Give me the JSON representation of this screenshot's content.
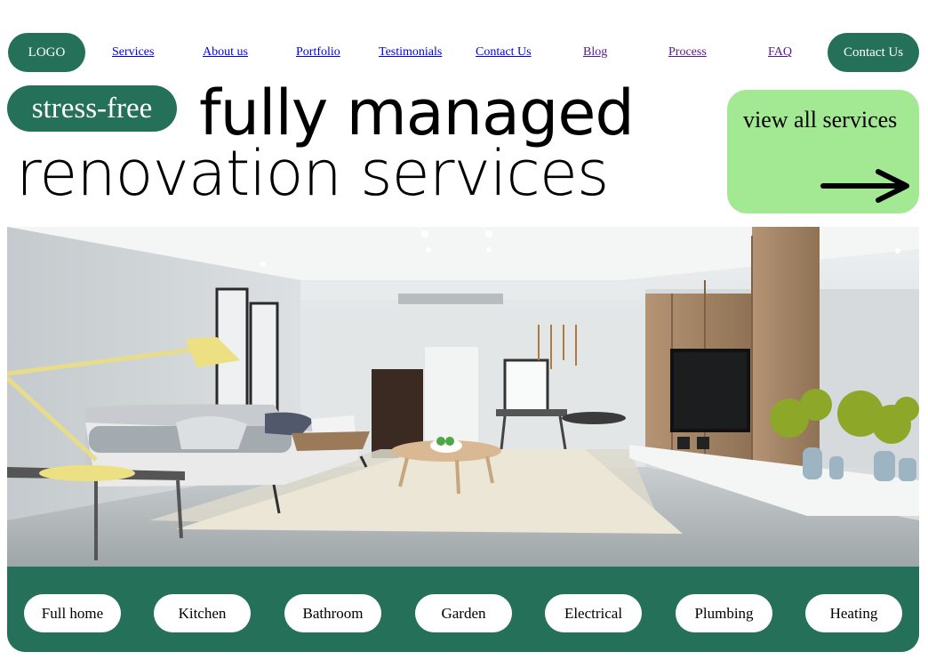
{
  "nav": {
    "logo": "LOGO",
    "links": [
      "Services",
      "About us",
      "Portfolio",
      "Testimonials",
      "Contact Us",
      "Blog",
      "Process",
      "FAQ"
    ],
    "cta": "Contact Us"
  },
  "hero": {
    "badge": "stress-free",
    "headline_line1": "fully managed",
    "headline_line2": "renovation services",
    "services_card": "view all services"
  },
  "categories": [
    "Full home",
    "Kitchen",
    "Bathroom",
    "Garden",
    "Electrical",
    "Plumbing",
    "Heating"
  ],
  "colors": {
    "brand_green": "#247058",
    "card_green": "#a3e994",
    "link_blue": "#0000ee",
    "link_visited": "#551a8b"
  },
  "icons": {
    "services_card": "arrow-right-icon"
  }
}
